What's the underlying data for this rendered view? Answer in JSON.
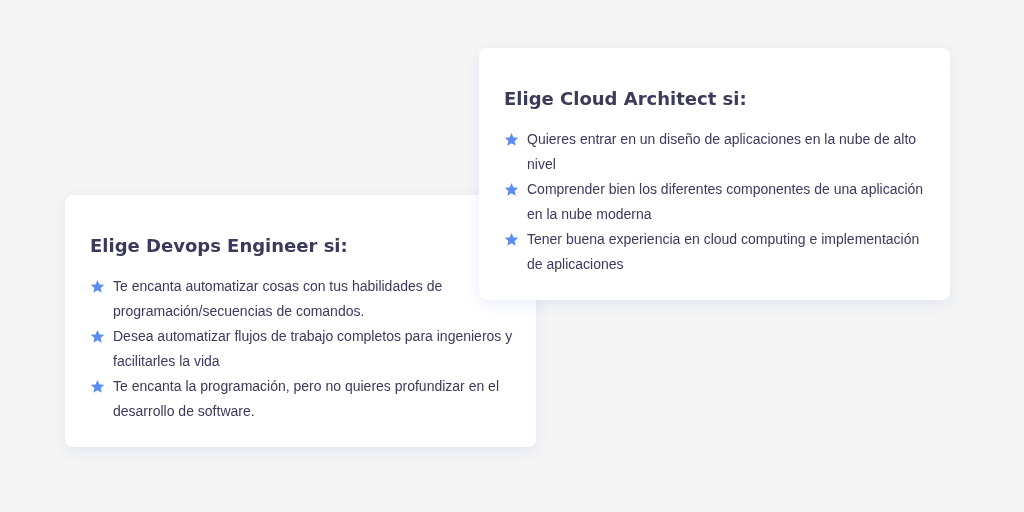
{
  "cards": [
    {
      "title": "Elige Devops Engineer si:",
      "items": [
        "Te encanta automatizar cosas con tus habilidades de programación/secuencias de comandos.",
        "Desea automatizar flujos de trabajo completos para ingenieros y facilitarles la vida",
        "Te encanta la programación, pero no quieres profundizar en el desarrollo de software."
      ]
    },
    {
      "title": "Elige Cloud Architect si:",
      "items": [
        "Quieres entrar en un diseño de aplicaciones en la nube de alto nivel",
        "Comprender bien los diferentes componentes de una aplicación en la nube moderna",
        "Tener buena experiencia en cloud computing e implementación de aplicaciones"
      ]
    }
  ]
}
